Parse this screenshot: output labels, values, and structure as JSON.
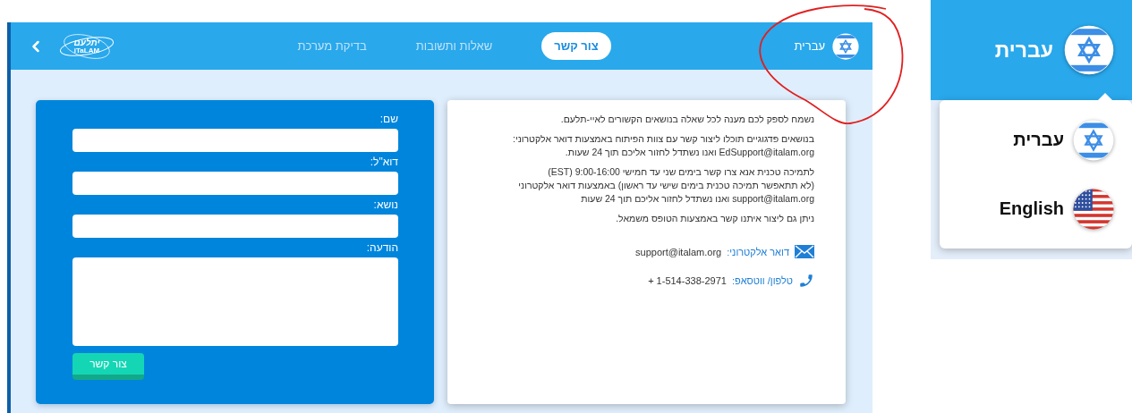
{
  "header": {
    "logo": {
      "hebrew": "יתלעם",
      "latin": "iTaLAM"
    },
    "nav": [
      {
        "label": "צור קשר",
        "selected": true
      },
      {
        "label": "שאלות ותשובות",
        "selected": false
      },
      {
        "label": "בדיקת מערכת",
        "selected": false
      }
    ],
    "language": "עברית"
  },
  "form": {
    "fields": [
      {
        "label": "שם:",
        "kind": "input"
      },
      {
        "label": "דוא\"ל:",
        "kind": "input"
      },
      {
        "label": "נושא:",
        "kind": "input"
      },
      {
        "label": "הודעה:",
        "kind": "textarea"
      }
    ],
    "submit": "צור קשר"
  },
  "info": {
    "paragraphs": [
      "נשמח לספק לכם מענה לכל שאלה בנושאים הקשורים לאיי-תלעם.",
      "בנושאים פדגוגיים תוכלו ליצור קשר עם צוות הפיתוח באמצעות דואר אלקטרוני:\nEdSupport@italam.org ואנו נשתדל לחזור אליכם תוך 24 שעות.",
      "לתמיכה טכנית אנא צרו קשר בימים שני עד חמישי 9:00-16:00 (EST)\n(לא תתאפשר תמיכה טכנית בימים שישי עד ראשון) באמצעות דואר אלקטרוני\nsupport@italam.org ואנו נשתדל לחזור אליכם תוך 24 שעות",
      "ניתן גם ליצור איתנו קשר באמצעות הטופס משמאל."
    ],
    "contacts": [
      {
        "kind": "email",
        "label": "דואר אלקטרוני:",
        "value": "support@italam.org"
      },
      {
        "kind": "phone",
        "label": "טלפון/ ווטסאפ:",
        "value": "+ 1-514-338-2971"
      }
    ]
  },
  "inset": {
    "language": "עברית",
    "menu": [
      {
        "label": "עברית",
        "kind": "israel"
      },
      {
        "label": "English",
        "kind": "usa"
      }
    ]
  }
}
